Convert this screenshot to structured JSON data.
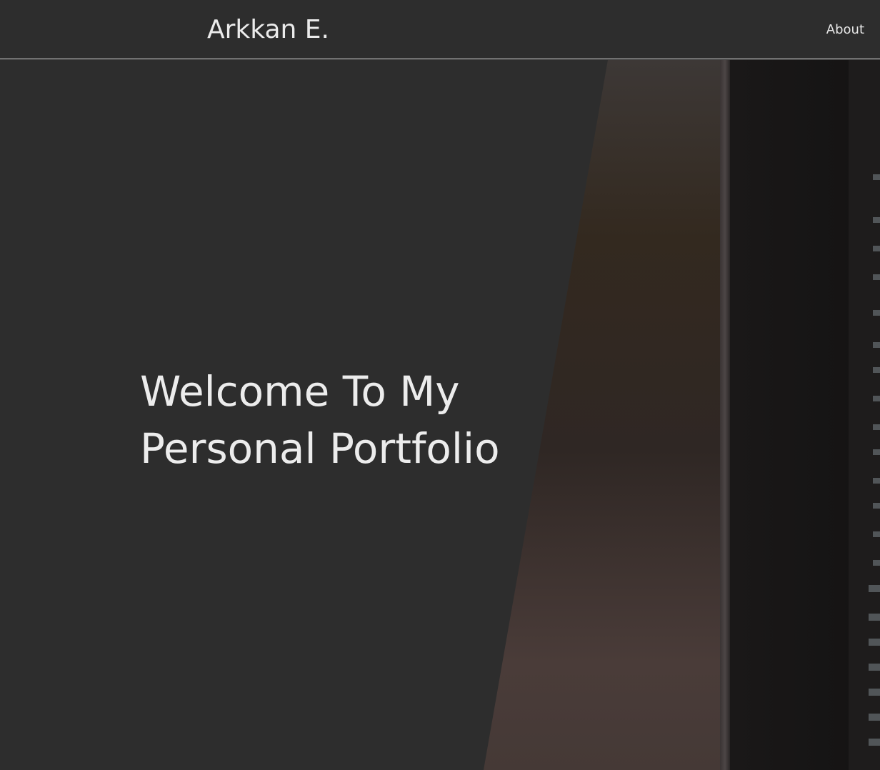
{
  "header": {
    "brand": "Arkkan E.",
    "nav": [
      {
        "label": "About"
      }
    ]
  },
  "hero": {
    "title": "Welcome To My Personal Portfolio"
  },
  "colors": {
    "background": "#2d2d2d",
    "text": "#ebebeb",
    "divider": "#d8d8d8"
  }
}
